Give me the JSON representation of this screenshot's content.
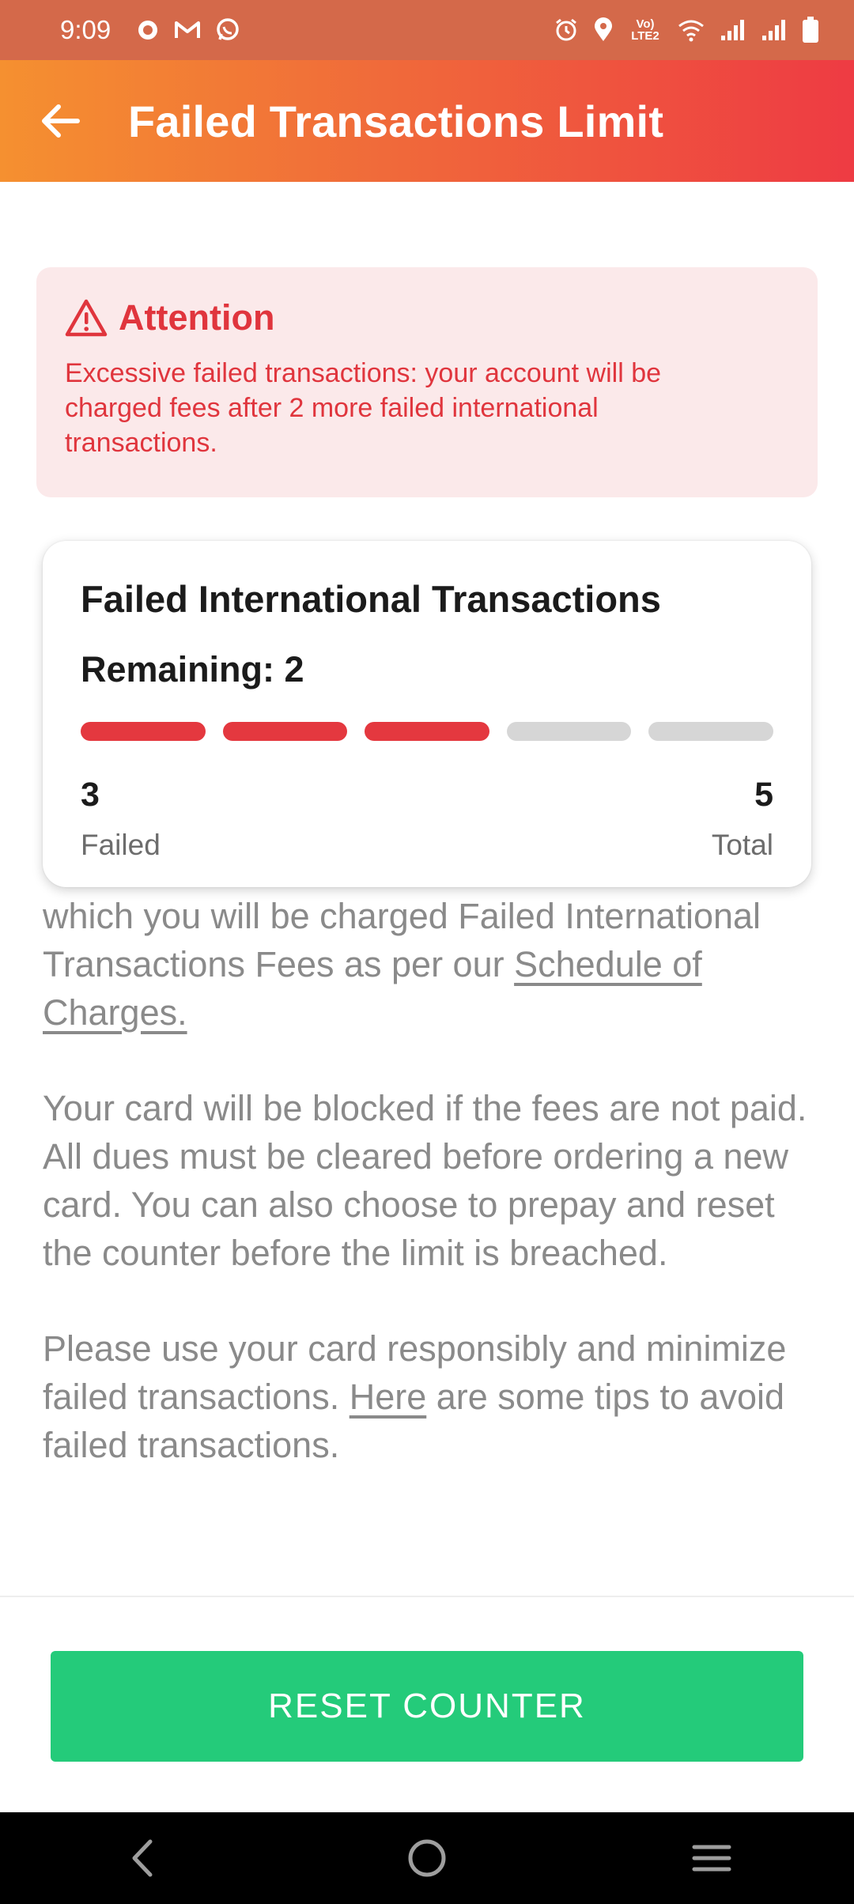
{
  "status_bar": {
    "time": "9:09",
    "left_icons": [
      "chat-icon",
      "gmail-icon",
      "whatsapp-icon"
    ],
    "right_icons": [
      "alarm-icon",
      "location-icon",
      "volte-icon",
      "wifi-icon",
      "signal-icon",
      "signal-icon",
      "battery-icon"
    ],
    "volte_text": "Vo) LTE2"
  },
  "app_bar": {
    "title": "Failed Transactions Limit",
    "back_icon": "arrow-left-icon"
  },
  "attention": {
    "icon": "warning-icon",
    "title": "Attention",
    "message": "Excessive failed transactions: your account will be charged fees after 2 more failed international transactions."
  },
  "card": {
    "title": "Failed International Transactions",
    "remaining_label": "Remaining: 2",
    "progress": {
      "failed": 3,
      "total": 5
    },
    "failed_value": "3",
    "failed_label": "Failed",
    "total_value": "5",
    "total_label": "Total"
  },
  "body": {
    "p1_text": "which you will be charged Failed International Transactions Fees as per our ",
    "p1_link": "Schedule of Charges.",
    "p2": "Your card will be blocked if the fees are not paid. All dues must be cleared before ordering a new card. You can also choose to prepay and reset the counter before the limit is breached.",
    "p3_before": "Please use your card responsibly and minimize failed transactions. ",
    "p3_link": "Here",
    "p3_after": " are some tips to avoid failed transactions."
  },
  "actions": {
    "reset_label": "RESET COUNTER"
  },
  "nav_bar": {
    "icons": [
      "back-icon",
      "home-icon",
      "menu-icon"
    ]
  },
  "colors": {
    "accent_red": "#e4383f",
    "green_button": "#24cb7a",
    "header_start": "#f59030",
    "header_end": "#ee3b43"
  }
}
